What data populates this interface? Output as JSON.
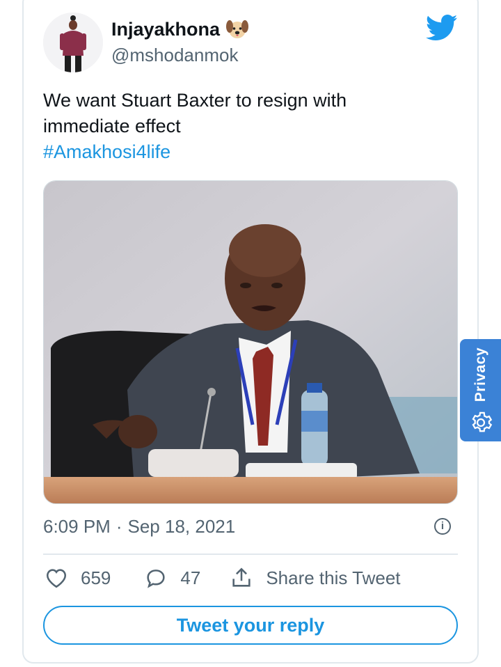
{
  "tweet": {
    "display_name": "Injayakhona",
    "handle": "@mshodanmok",
    "text_line1": "We want Stuart Baxter to resign with",
    "text_line2": "immediate effect",
    "hashtag": "#Amakhosi4life",
    "time": "6:09 PM",
    "separator": "·",
    "date": "Sep 18, 2021",
    "likes_count": "659",
    "replies_count": "47",
    "share_label": "Share this Tweet",
    "reply_button_label": "Tweet your reply"
  },
  "privacy_widget": {
    "label": "Privacy"
  },
  "icons": {
    "verified_emoji": "dog-face-icon",
    "brand": "twitter-bird-icon",
    "info": "info-icon",
    "like": "heart-icon",
    "reply": "comment-bubble-icon",
    "share": "share-upload-icon",
    "settings": "gear-icon"
  },
  "colors": {
    "accent": "#1b95e0",
    "text": "#0f1419",
    "muted": "#536471",
    "privacy_bg": "#3b82d6"
  }
}
